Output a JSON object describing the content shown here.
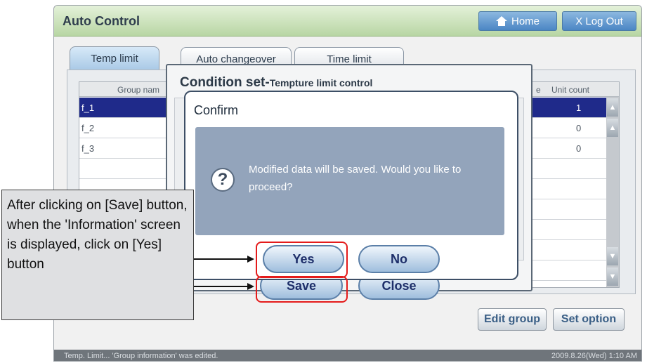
{
  "window": {
    "title": "Auto Control",
    "home_label": "Home",
    "logout_label": "X Log Out"
  },
  "tabs": [
    {
      "label": "Temp limit"
    },
    {
      "label": "Auto changeover"
    },
    {
      "label": "Time limit"
    }
  ],
  "table": {
    "headers": {
      "group": "Group nam",
      "partial": "e",
      "unit_count": "Unit count"
    },
    "rows": [
      {
        "group": "f_1",
        "unit_count": "1"
      },
      {
        "group": "f_2",
        "unit_count": "0"
      },
      {
        "group": "f_3",
        "unit_count": "0"
      }
    ]
  },
  "buttons": {
    "edit_group": "Edit group",
    "set_option": "Set option"
  },
  "status": {
    "message": "Temp. Limit... 'Group information' was edited.",
    "datetime": "2009.8.26(Wed)  1:10 AM"
  },
  "condition_dialog": {
    "title": "Condition set-",
    "subtitle": "Tempture limit control",
    "save_label": "Save",
    "close_label": "Close"
  },
  "confirm_dialog": {
    "title": "Confirm",
    "message": "Modified data will be saved.  Would you like to proceed?",
    "yes_label": "Yes",
    "no_label": "No",
    "icon": "question-icon"
  },
  "annotation": {
    "text": "After clicking on [Save] button, when the 'Information' screen is displayed, click on [Yes] button",
    "highlight_color": "#e41b1b"
  },
  "colors": {
    "titlebar": "#b8d6a4",
    "selected_row": "#1f2a8a",
    "confirm_body": "#93a4bb"
  }
}
